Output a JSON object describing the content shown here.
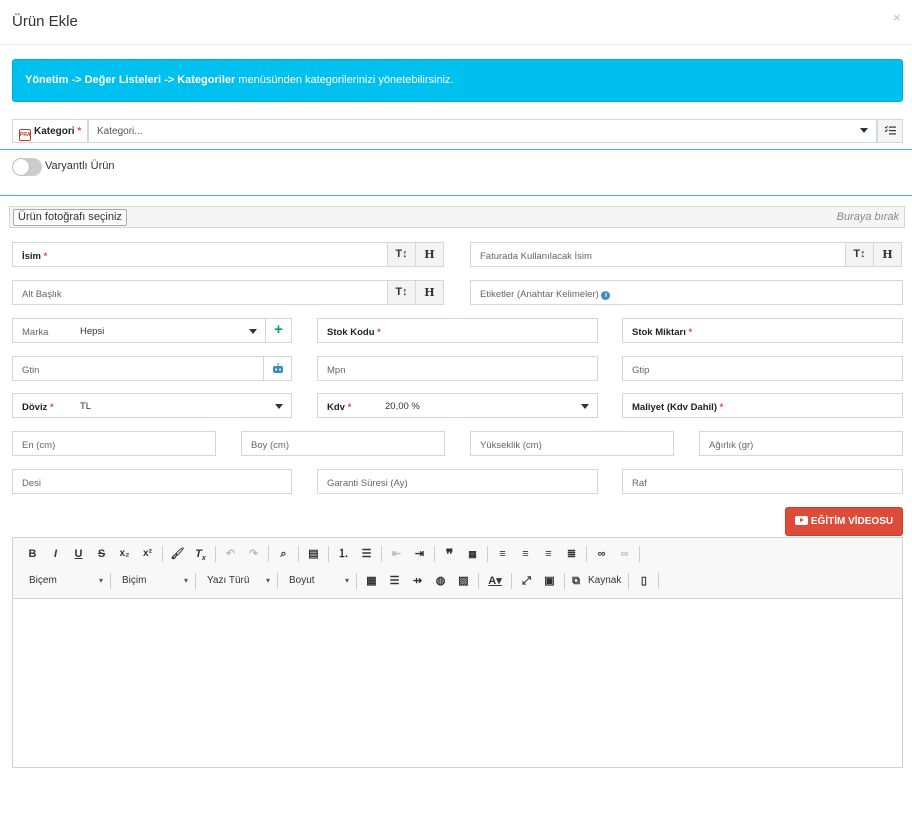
{
  "modal": {
    "title": "Ürün Ekle",
    "close_symbol": "×"
  },
  "alert": {
    "path": "Yönetim -> Değer Listeleri -> Kategoriler",
    "rest": " menüsünden kategorilerinizi yönetebilirsiniz."
  },
  "category": {
    "badge": "PRA",
    "label": "Kategori",
    "required": "*",
    "value": "Kategori..."
  },
  "variant": {
    "label": "Varyantlı Ürün",
    "on": false
  },
  "photo": {
    "button": "Ürün fotoğrafı seçiniz",
    "drop": "Buraya bırak"
  },
  "fields": {
    "isim": {
      "label": "İsim",
      "required": "*",
      "value": "",
      "btn1": "T↕",
      "btn2": "H"
    },
    "fatura_isim": {
      "label": "Faturada Kullanılacak İsim",
      "value": "",
      "btn1": "T↕",
      "btn2": "H"
    },
    "alt_baslik": {
      "label": "Alt Başlık",
      "value": "",
      "btn1": "T↕",
      "btn2": "H"
    },
    "etiketler": {
      "label": "Etiketler (Anahtar Kelimeler)",
      "info": "i",
      "value": ""
    },
    "marka": {
      "label": "Marka",
      "value": "Hepsi",
      "add": "+"
    },
    "stok_kodu": {
      "label": "Stok Kodu",
      "required": "*",
      "value": ""
    },
    "stok_miktari": {
      "label": "Stok Miktarı",
      "required": "*",
      "value": ""
    },
    "gtin": {
      "label": "Gtin",
      "value": ""
    },
    "mpn": {
      "label": "Mpn",
      "value": ""
    },
    "gtip": {
      "label": "Gtip",
      "value": ""
    },
    "doviz": {
      "label": "Döviz",
      "required": "*",
      "value": "TL"
    },
    "kdv": {
      "label": "Kdv",
      "required": "*",
      "value": "20,00 %"
    },
    "maliyet": {
      "label": "Maliyet (Kdv Dahil)",
      "required": "*",
      "value": ""
    },
    "en": {
      "label": "En (cm)",
      "value": ""
    },
    "boy": {
      "label": "Boy (cm)",
      "value": ""
    },
    "yukseklik": {
      "label": "Yükseklik (cm)",
      "value": ""
    },
    "agirlik": {
      "label": "Ağırlık (gr)",
      "value": ""
    },
    "desi": {
      "label": "Desi",
      "value": ""
    },
    "garanti": {
      "label": "Garanti Süresi (Ay)",
      "value": ""
    },
    "raf": {
      "label": "Raf",
      "value": ""
    }
  },
  "video_button": {
    "label": "EĞİTİM VİDEOSU"
  },
  "editor": {
    "bold": "B",
    "italic": "I",
    "underline": "U",
    "strike": "S",
    "sub": "x₂",
    "sup": "x²",
    "format_combo": "Biçem",
    "block_combo": "Biçim",
    "font_combo": "Yazı Türü",
    "size_combo": "Boyut",
    "source": "Kaynak"
  }
}
